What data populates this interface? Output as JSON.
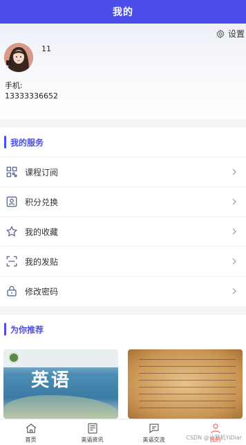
{
  "header": {
    "title": "我的"
  },
  "profile": {
    "settings_label": "设置",
    "username": "11",
    "phone_label": "手机:",
    "phone_value": "13333336652"
  },
  "services": {
    "title": "我的服务",
    "items": [
      {
        "label": "课程订阅",
        "icon": "grid-scan-icon"
      },
      {
        "label": "积分兑换",
        "icon": "id-card-icon"
      },
      {
        "label": "我的收藏",
        "icon": "star-icon"
      },
      {
        "label": "我的发贴",
        "icon": "scan-frame-icon"
      },
      {
        "label": "修改密码",
        "icon": "lock-icon"
      }
    ]
  },
  "recommend": {
    "title": "为你推荐",
    "book1_text": "英语"
  },
  "nav": {
    "items": [
      {
        "label": "首页",
        "icon": "home-icon"
      },
      {
        "label": "英语资讯",
        "icon": "news-icon"
      },
      {
        "label": "英语交流",
        "icon": "chat-icon"
      },
      {
        "label": "我的",
        "icon": "user-icon"
      }
    ]
  },
  "watermark": "CSDN @计算机YiDiar",
  "colors": {
    "accent": "#4b4ee8",
    "active": "#e65a5a"
  }
}
